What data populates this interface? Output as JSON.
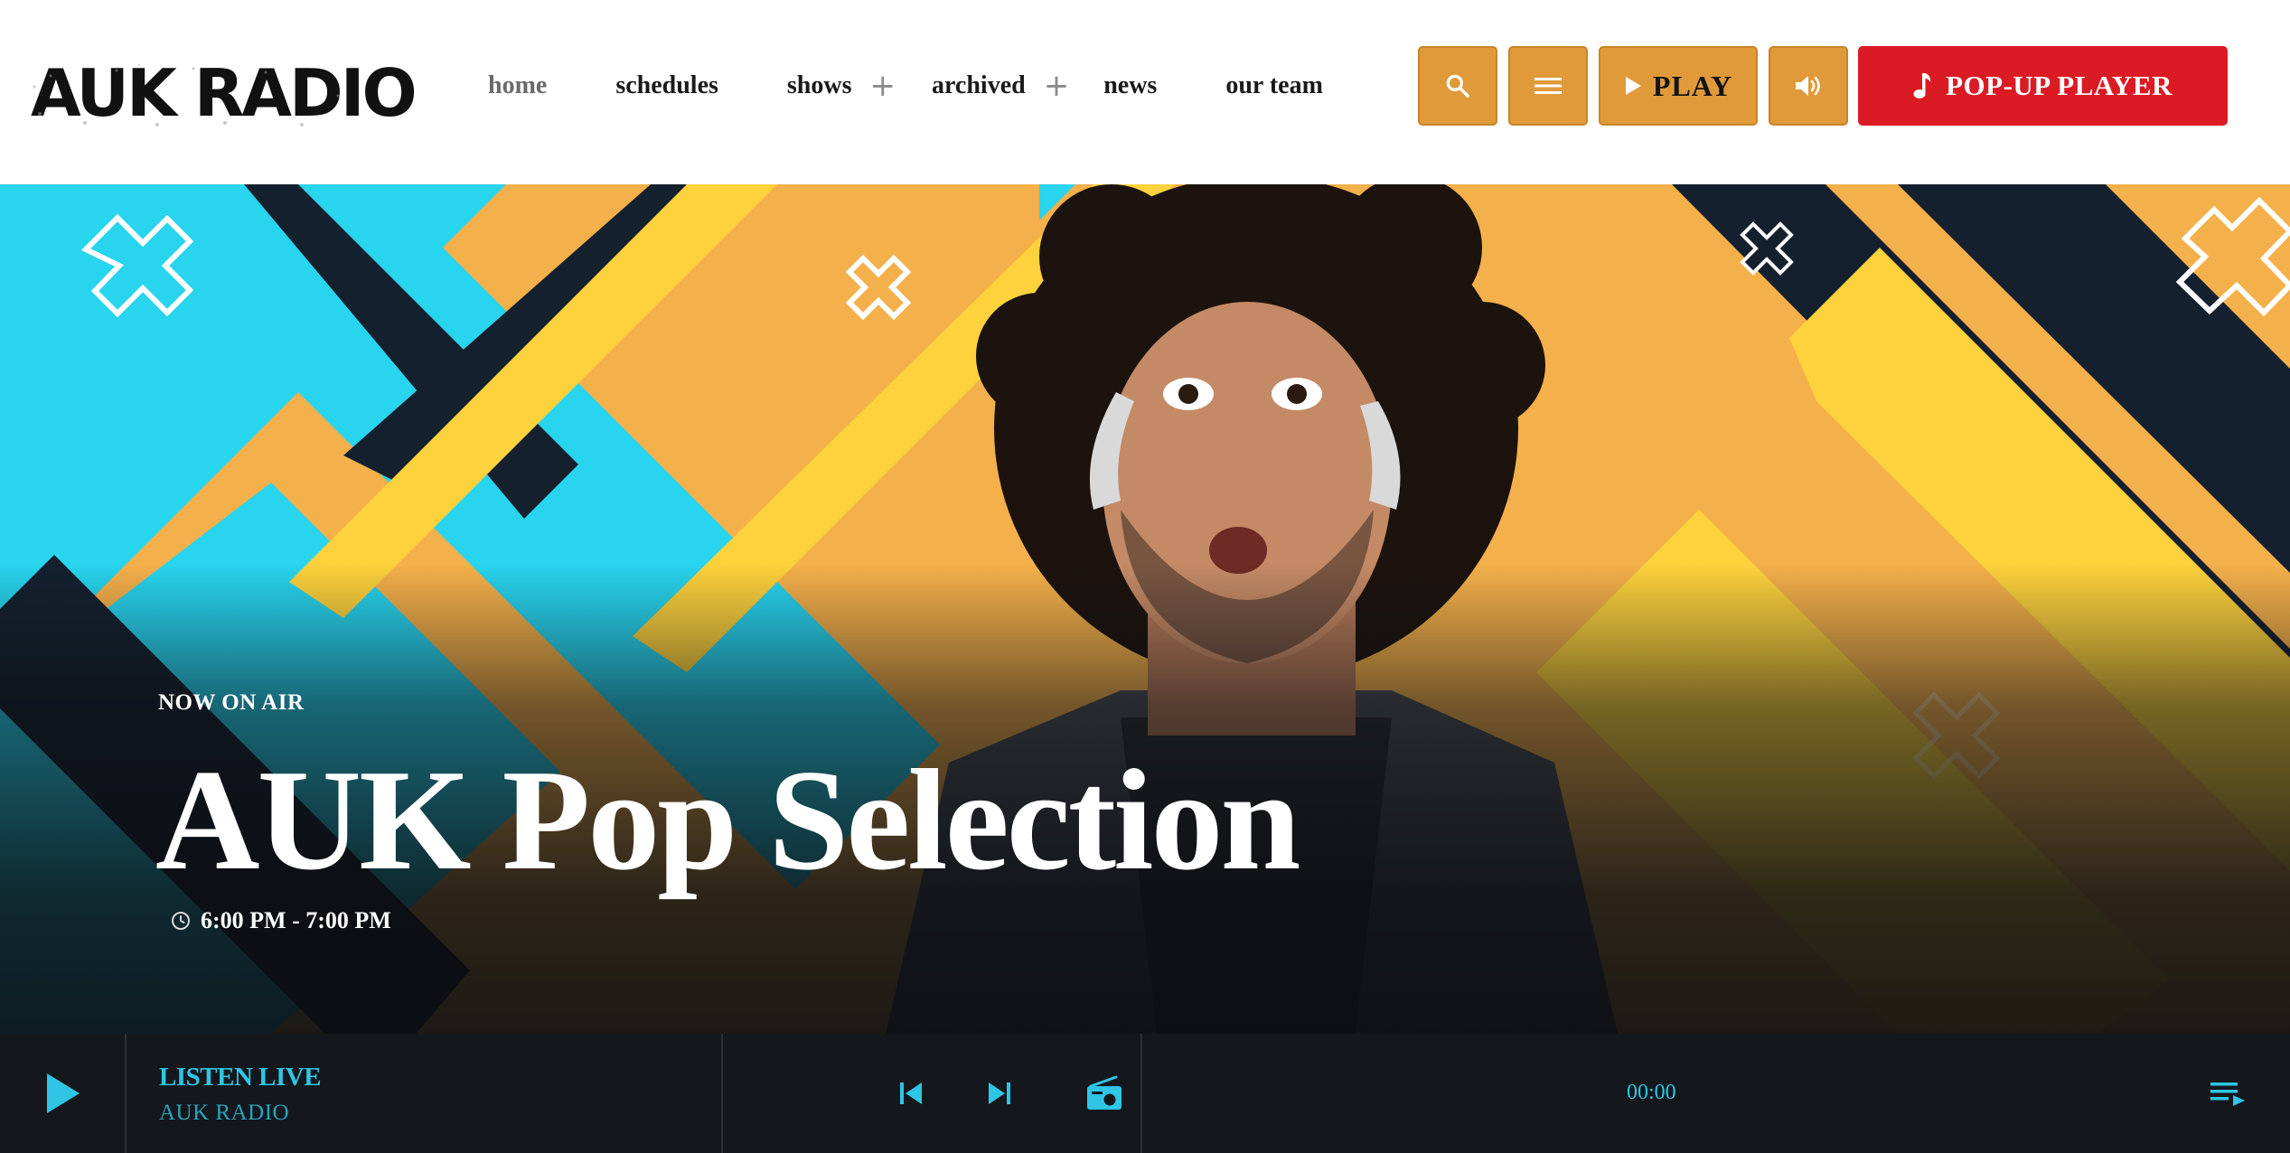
{
  "brand": {
    "logo_text": "AUK RADIO",
    "colors": {
      "accent_orange": "#e09a3a",
      "popup_red": "#db1b24",
      "player_cyan": "#2fc5e6",
      "player_bg": "#14181c"
    }
  },
  "nav": {
    "items": [
      {
        "label": "home",
        "active": true,
        "has_submenu": false
      },
      {
        "label": "schedules",
        "active": false,
        "has_submenu": false
      },
      {
        "label": "shows",
        "active": false,
        "has_submenu": true
      },
      {
        "label": "archived",
        "active": false,
        "has_submenu": true
      },
      {
        "label": "news",
        "active": false,
        "has_submenu": false
      },
      {
        "label": "our team",
        "active": false,
        "has_submenu": false
      }
    ],
    "submenu_symbol": "+"
  },
  "header_buttons": {
    "search_icon": "search-icon",
    "menu_icon": "hamburger-menu-icon",
    "play_label": "PLAY",
    "volume_icon": "volume-icon",
    "popup_label": "POP-UP PLAYER",
    "popup_icon": "music-note-icon"
  },
  "hero": {
    "kicker": "NOW ON AIR",
    "title": "AUK Pop Selection",
    "time": "6:00 PM - 7:00 PM",
    "time_icon": "clock-icon"
  },
  "player": {
    "play_icon": "play-icon",
    "listen_label": "LISTEN LIVE",
    "station": "AUK RADIO",
    "prev_icon": "skip-previous-icon",
    "next_icon": "skip-next-icon",
    "radio_icon": "radio-icon",
    "time": "00:00",
    "playlist_icon": "playlist-icon"
  }
}
